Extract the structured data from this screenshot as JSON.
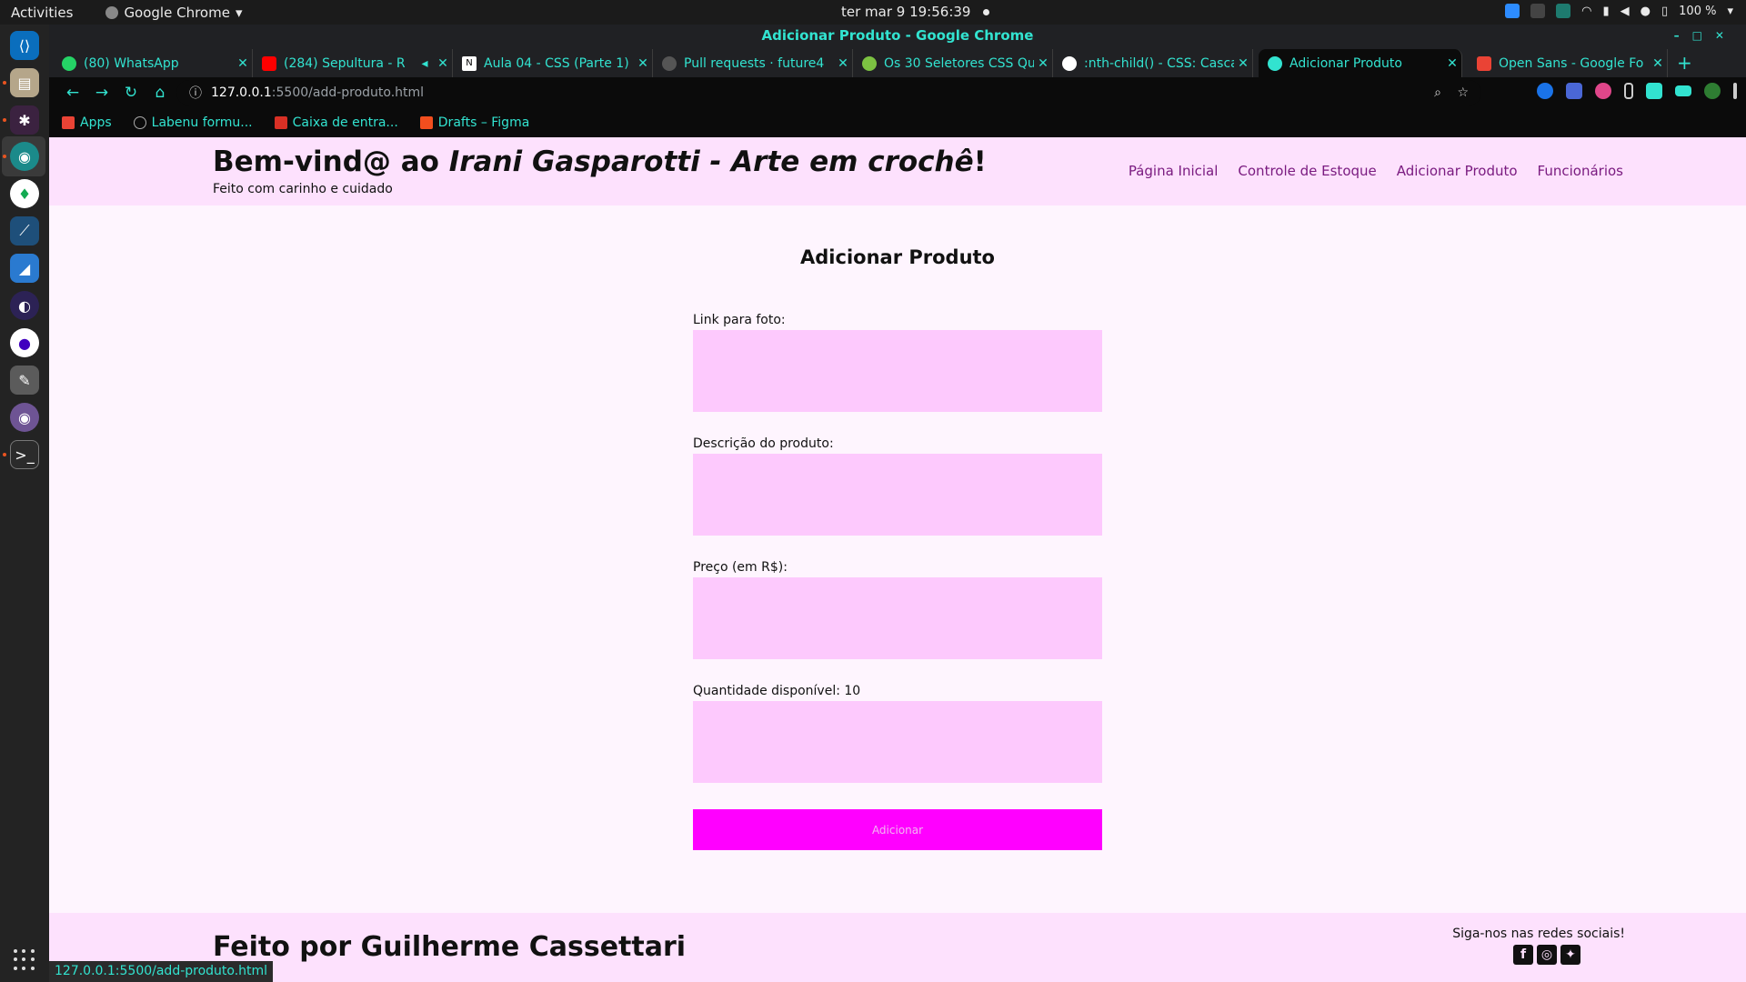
{
  "system": {
    "activities": "Activities",
    "app_menu": "Google Chrome",
    "clock": "ter mar 9  19:56:39",
    "battery": "100 %"
  },
  "window": {
    "title": "Adicionar Produto - Google Chrome"
  },
  "tabs": [
    {
      "label": "(80) WhatsApp",
      "color": "#25d366"
    },
    {
      "label": "(284) Sepultura - R",
      "color": "#ff0000"
    },
    {
      "label": "Aula 04 - CSS (Parte 1)",
      "color": "#ffffff"
    },
    {
      "label": "Pull requests · future4",
      "color": "#555555"
    },
    {
      "label": "Os 30 Seletores CSS Qu",
      "color": "#7cc242"
    },
    {
      "label": ":nth-child() - CSS: Casca",
      "color": "#ffffff"
    },
    {
      "label": "Adicionar Produto",
      "color": "#32e3d0"
    },
    {
      "label": "Open Sans - Google Fo",
      "color": "#ea4335"
    }
  ],
  "address": {
    "host": "127.0.0.1",
    "path": ":5500/add-produto.html"
  },
  "bookmarks": [
    {
      "label": "Apps"
    },
    {
      "label": "Labenu formu..."
    },
    {
      "label": "Caixa de entra..."
    },
    {
      "label": "Drafts – Figma"
    }
  ],
  "header": {
    "title_prefix": "Bem-vind@ ao ",
    "title_brand": "Irani Gasparotti - Arte em crochê",
    "title_suffix": "!",
    "subtitle": "Feito com carinho e cuidado",
    "nav": [
      "Página Inicial",
      "Controle de Estoque",
      "Adicionar Produto",
      "Funcionários"
    ]
  },
  "form": {
    "title": "Adicionar Produto",
    "fields": [
      {
        "label": "Link para foto:"
      },
      {
        "label": "Descrição do produto:"
      },
      {
        "label": "Preço (em R$):"
      },
      {
        "label": "Quantidade disponível: 10"
      }
    ],
    "submit_label": "Adicionar"
  },
  "footer": {
    "title": "Feito por Guilherme Cassettari",
    "social_label": "Siga-nos nas redes sociais!"
  },
  "status_url": "127.0.0.1:5500/add-produto.html",
  "colors": {
    "accent": "#32e3d0",
    "header_bg": "#fde1fd",
    "input_bg": "#fdc9fd",
    "button_bg": "#ff00ff",
    "nav_link": "#7a1b80"
  }
}
